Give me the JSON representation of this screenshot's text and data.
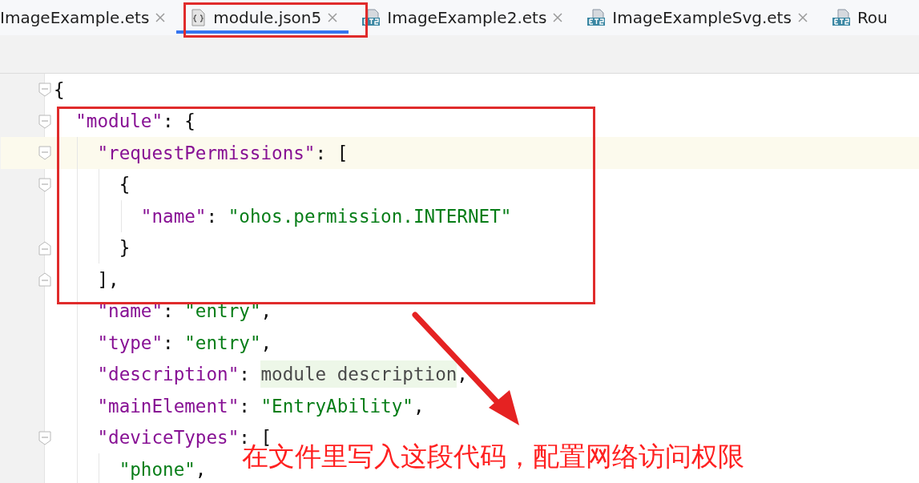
{
  "tabs": [
    {
      "label": "ImageExample.ets",
      "selected": false,
      "closable": true
    },
    {
      "label": "module.json5",
      "selected": true,
      "closable": true
    },
    {
      "label": "ImageExample2.ets",
      "selected": false,
      "closable": true
    },
    {
      "label": "ImageExampleSvg.ets",
      "selected": false,
      "closable": true
    },
    {
      "label": "Rou",
      "selected": false,
      "closable": false
    }
  ],
  "editor": {
    "lines": [
      {
        "current": false,
        "tokens": [
          {
            "kind": "punct",
            "text": "{"
          }
        ],
        "children": [
          {
            "current": false,
            "tokens": [
              {
                "kind": "key",
                "text": "\"module\""
              },
              {
                "kind": "punct",
                "text": ": {"
              }
            ],
            "children": [
              {
                "current": true,
                "tokens": [
                  {
                    "kind": "key",
                    "text": "\"requestPermissions\""
                  },
                  {
                    "kind": "punct",
                    "text": ": ["
                  }
                ],
                "closer": "],",
                "children": [
                  {
                    "current": false,
                    "tokens": [
                      {
                        "kind": "punct",
                        "text": "{"
                      }
                    ],
                    "closer": "}",
                    "children": [
                      {
                        "current": false,
                        "tokens": [
                          {
                            "kind": "key",
                            "text": "\"name\""
                          },
                          {
                            "kind": "punct",
                            "text": ": "
                          },
                          {
                            "kind": "str",
                            "text": "\"ohos.permission.INTERNET\""
                          }
                        ]
                      }
                    ]
                  }
                ]
              },
              {
                "current": false,
                "tokens": [
                  {
                    "kind": "key",
                    "text": "\"name\""
                  },
                  {
                    "kind": "punct",
                    "text": ": "
                  },
                  {
                    "kind": "str",
                    "text": "\"entry\""
                  },
                  {
                    "kind": "punct",
                    "text": ","
                  }
                ]
              },
              {
                "current": false,
                "tokens": [
                  {
                    "kind": "key",
                    "text": "\"type\""
                  },
                  {
                    "kind": "punct",
                    "text": ": "
                  },
                  {
                    "kind": "str",
                    "text": "\"entry\""
                  },
                  {
                    "kind": "punct",
                    "text": ","
                  }
                ]
              },
              {
                "current": false,
                "tokens": [
                  {
                    "kind": "key",
                    "text": "\"description\""
                  },
                  {
                    "kind": "punct",
                    "text": ": "
                  },
                  {
                    "kind": "hint",
                    "text": "module description"
                  },
                  {
                    "kind": "punct",
                    "text": ","
                  }
                ]
              },
              {
                "current": false,
                "tokens": [
                  {
                    "kind": "key",
                    "text": "\"mainElement\""
                  },
                  {
                    "kind": "punct",
                    "text": ": "
                  },
                  {
                    "kind": "str",
                    "text": "\"EntryAbility\""
                  },
                  {
                    "kind": "punct",
                    "text": ","
                  }
                ]
              },
              {
                "current": false,
                "tokens": [
                  {
                    "kind": "key",
                    "text": "\"deviceTypes\""
                  },
                  {
                    "kind": "punct",
                    "text": ": ["
                  }
                ],
                "children": [
                  {
                    "current": false,
                    "tokens": [
                      {
                        "kind": "str",
                        "text": "\"phone\""
                      },
                      {
                        "kind": "punct",
                        "text": ","
                      }
                    ]
                  }
                ]
              }
            ]
          }
        ]
      }
    ]
  },
  "annotation": {
    "caption": "在文件里写入这段代码，配置网络访问权限"
  }
}
